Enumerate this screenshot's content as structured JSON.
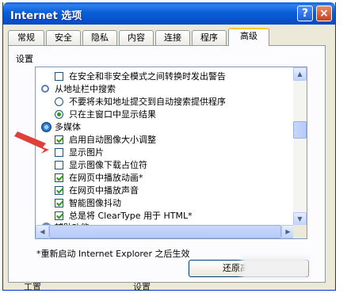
{
  "window": {
    "title": "Internet 选项",
    "help_label": "?",
    "close_label": "×"
  },
  "tabs": [
    {
      "label": "常规",
      "active": false
    },
    {
      "label": "安全",
      "active": false
    },
    {
      "label": "隐私",
      "active": false
    },
    {
      "label": "内容",
      "active": false
    },
    {
      "label": "连接",
      "active": false
    },
    {
      "label": "程序",
      "active": false
    },
    {
      "label": "高级",
      "active": true
    }
  ],
  "settings": {
    "group_label": "设置",
    "items": [
      {
        "kind": "checkbox",
        "label": "在安全和非安全模式之间转换时发出警告",
        "checked": false
      },
      {
        "kind": "category",
        "icon": "search-icon",
        "label": "从地址栏中搜索"
      },
      {
        "kind": "radio",
        "label": "不要将未知地址提交到自动搜索提供程序",
        "checked": false
      },
      {
        "kind": "radio",
        "label": "只在主窗口中显示结果",
        "checked": true
      },
      {
        "kind": "category",
        "icon": "multimedia-icon",
        "label": "多媒体"
      },
      {
        "kind": "checkbox",
        "label": "启用自动图像大小调整",
        "checked": true
      },
      {
        "kind": "checkbox",
        "label": "显示图片",
        "checked": false
      },
      {
        "kind": "checkbox",
        "label": "显示图像下载占位符",
        "checked": false
      },
      {
        "kind": "checkbox",
        "label": "在网页中播放动画*",
        "checked": true
      },
      {
        "kind": "checkbox",
        "label": "在网页中播放声音",
        "checked": true
      },
      {
        "kind": "checkbox",
        "label": "智能图像抖动",
        "checked": true
      },
      {
        "kind": "checkbox",
        "label": "总是将 ClearType 用于 HTML*",
        "checked": true
      },
      {
        "kind": "category",
        "icon": "accessibility-icon",
        "label": "辅助功能"
      }
    ]
  },
  "footer": {
    "restart_note": "*重新启动 Internet Explorer 之后生效",
    "restore_button": "还原高级设置",
    "bottom_left": "工置",
    "bottom_mid": "设置"
  },
  "colors": {
    "title_bar": "#0a5fd8",
    "face": "#ece9d8",
    "check": "#21a121",
    "arrow": "#e0403a"
  }
}
